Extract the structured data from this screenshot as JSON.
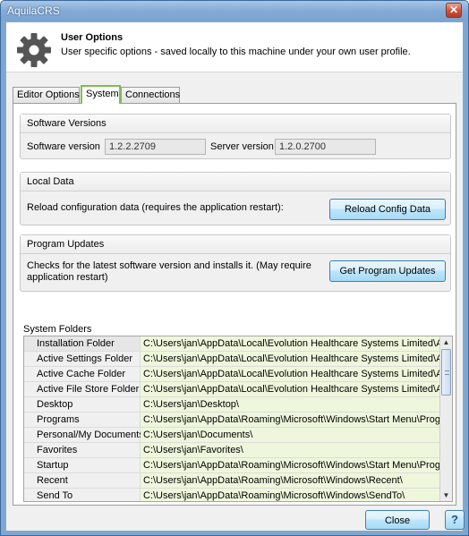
{
  "window": {
    "title": "AquilaCRS",
    "close_glyph": "✕"
  },
  "header": {
    "title": "User Options",
    "subtitle": "User specific options - saved locally to this machine under your own user profile.",
    "icon": "gear-icon"
  },
  "tabs": [
    {
      "label": "Editor Options",
      "active": false
    },
    {
      "label": "System",
      "active": true
    },
    {
      "label": "Connections",
      "active": false
    }
  ],
  "software_versions": {
    "title": "Software Versions",
    "software_label": "Software version",
    "software_value": "1.2.2.2709",
    "server_label": "Server version",
    "server_value": "1.2.0.2700"
  },
  "local_data": {
    "title": "Local Data",
    "description": "Reload configuration data (requires the application restart):",
    "button_label": "Reload Config Data"
  },
  "program_updates": {
    "title": "Program Updates",
    "description_line1": "Checks for the latest software version and installs it.  (May require",
    "description_line2": "application restart)",
    "button_label": "Get Program Updates"
  },
  "system_folders": {
    "title": "System Folders",
    "rows": [
      {
        "name": "Installation Folder",
        "path": "C:\\Users\\jan\\AppData\\Local\\Evolution Healthcare Systems Limited\\Aquila"
      },
      {
        "name": "Active Settings Folder",
        "path": "C:\\Users\\jan\\AppData\\Local\\Evolution Healthcare Systems Limited\\Aquila"
      },
      {
        "name": "Active Cache Folder",
        "path": "C:\\Users\\jan\\AppData\\Local\\Evolution Healthcare Systems Limited\\Aquila"
      },
      {
        "name": "Active File Store Folder",
        "path": "C:\\Users\\jan\\AppData\\Local\\Evolution Healthcare Systems Limited\\Aquila"
      },
      {
        "name": "Desktop",
        "path": "C:\\Users\\jan\\Desktop\\"
      },
      {
        "name": "Programs",
        "path": "C:\\Users\\jan\\AppData\\Roaming\\Microsoft\\Windows\\Start Menu\\Programs"
      },
      {
        "name": "Personal/My Documents",
        "path": "C:\\Users\\jan\\Documents\\"
      },
      {
        "name": "Favorites",
        "path": "C:\\Users\\jan\\Favorites\\"
      },
      {
        "name": "Startup",
        "path": "C:\\Users\\jan\\AppData\\Roaming\\Microsoft\\Windows\\Start Menu\\Programs"
      },
      {
        "name": "Recent",
        "path": "C:\\Users\\jan\\AppData\\Roaming\\Microsoft\\Windows\\Recent\\"
      },
      {
        "name": "Send To",
        "path": "C:\\Users\\jan\\AppData\\Roaming\\Microsoft\\Windows\\SendTo\\"
      }
    ]
  },
  "footer": {
    "close_label": "Close",
    "help_glyph": "?"
  },
  "colors": {
    "path_cell_bg": "#eef7dc",
    "active_tab_border": "#7fbf4d",
    "title_bar": "#84abd6"
  }
}
